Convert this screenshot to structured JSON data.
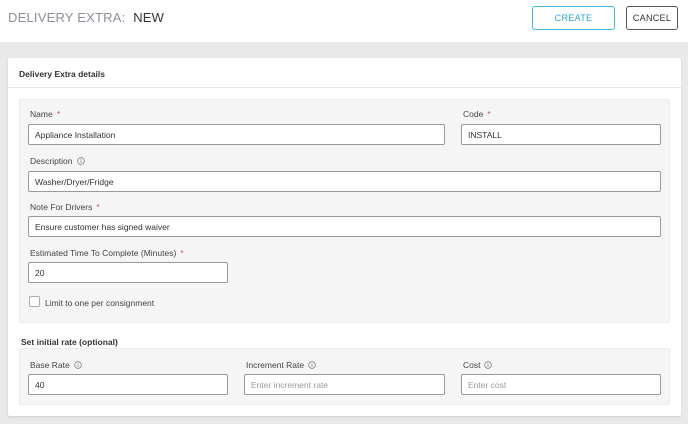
{
  "header": {
    "title_prefix": "DELIVERY EXTRA:",
    "title_value": "NEW",
    "create_label": "CREATE",
    "cancel_label": "CANCEL"
  },
  "card": {
    "title": "Delivery Extra details"
  },
  "fields": {
    "name": {
      "label": "Name",
      "required": "*",
      "value": "Appliance Installation"
    },
    "code": {
      "label": "Code",
      "required": "*",
      "value": "INSTALL"
    },
    "description": {
      "label": "Description",
      "value": "Washer/Dryer/Fridge"
    },
    "note": {
      "label": "Note For Drivers",
      "required": "*",
      "value": "Ensure customer has signed waiver"
    },
    "time": {
      "label": "Estimated Time To Complete (Minutes)",
      "required": "*",
      "value": "20"
    },
    "limit": {
      "label": "Limit to one per consignment"
    }
  },
  "rates": {
    "section_title": "Set initial rate (optional)",
    "base": {
      "label": "Base Rate",
      "value": "40"
    },
    "increment": {
      "label": "Increment Rate",
      "placeholder": "Enter increment rate"
    },
    "cost": {
      "label": "Cost",
      "placeholder": "Enter cost"
    }
  },
  "colors": {
    "accent": "#2ba6d8",
    "required": "#d9534f",
    "background": "#e9e9e9"
  },
  "icons": [
    "info-icon"
  ]
}
